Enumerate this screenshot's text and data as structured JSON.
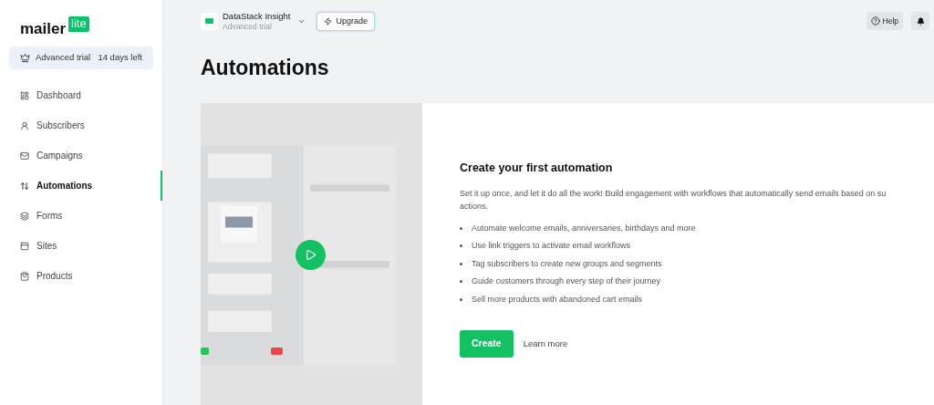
{
  "logo": {
    "word": "mailer",
    "badge": "lite"
  },
  "trial": {
    "label": "Advanced trial",
    "days": "14 days left"
  },
  "sidebar": {
    "items": [
      {
        "label": "Dashboard",
        "selected": false
      },
      {
        "label": "Subscribers",
        "selected": false
      },
      {
        "label": "Campaigns",
        "selected": false
      },
      {
        "label": "Automations",
        "selected": true
      },
      {
        "label": "Forms",
        "selected": false
      },
      {
        "label": "Sites",
        "selected": false
      },
      {
        "label": "Products",
        "selected": false
      }
    ]
  },
  "account": {
    "name": "DataStack Insight",
    "plan": "Advanced trial"
  },
  "upgrade_button": "Upgrade",
  "help_button": "Help",
  "page_title": "Automations",
  "promo": {
    "heading": "Create your first automation",
    "description_lines": [
      "Set it up once, and let it do all the work! Build engagement with workflows that automatically send emails based on su",
      "actions."
    ],
    "bullets": [
      "Automate welcome emails, anniversaries, birthdays and more",
      "Use link triggers to activate email workflows",
      "Tag subscribers to create new groups and segments",
      "Guide customers through every step of their journey",
      "Sell more products with abandoned cart emails"
    ],
    "create_button": "Create",
    "learn_more": "Learn more"
  }
}
